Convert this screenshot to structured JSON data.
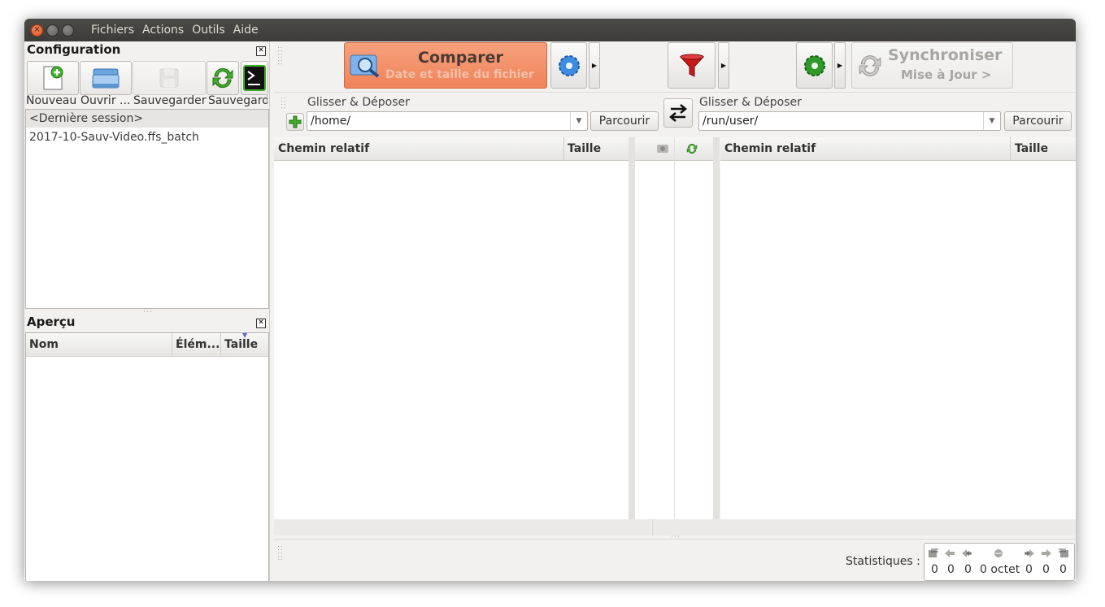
{
  "menu": [
    "Fichiers",
    "Actions",
    "Outils",
    "Aide"
  ],
  "config": {
    "title": "Configuration",
    "buttons": [
      {
        "label": "Nouveau",
        "icon": "new-file-icon"
      },
      {
        "label": "Ouvrir ...",
        "icon": "open-folder-icon"
      },
      {
        "label": "Sauvegarder",
        "icon": "save-icon"
      },
      {
        "label": "Sauvegard",
        "icon": "save-as-batch-icon"
      }
    ],
    "items": [
      "<Dernière session>",
      "2017-10-Sauv-Video.ffs_batch"
    ]
  },
  "overview": {
    "title": "Aperçu",
    "columns": [
      "Nom",
      "Élém...",
      "Taille"
    ]
  },
  "toolbar": {
    "compare_label": "Comparer",
    "compare_sub": "Date et taille du fichier",
    "sync_label": "Synchroniser",
    "sync_sub": "Mise à Jour >"
  },
  "left": {
    "dnd": "Glisser & Déposer",
    "path": "/home/",
    "browse": "Parcourir",
    "columns": [
      "Chemin relatif",
      "Taille"
    ]
  },
  "right": {
    "dnd": "Glisser & Déposer",
    "path": "/run/user/",
    "browse": "Parcourir",
    "columns": [
      "Chemin relatif",
      "Taille"
    ]
  },
  "status": {
    "label": "Statistiques :",
    "values": [
      "0",
      "0",
      "0",
      "0 octet",
      "0",
      "0",
      "0"
    ]
  },
  "colors": {
    "compare_bg": "#f0835a",
    "titlebar": "#3c3b37"
  }
}
